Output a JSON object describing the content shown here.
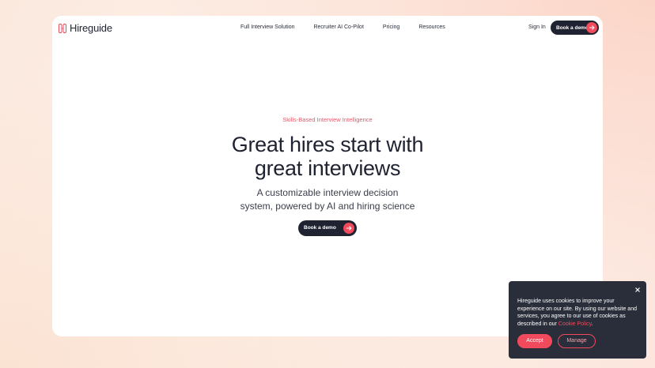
{
  "brand": {
    "name": "Hireguide",
    "accent": "#f04a5c",
    "dark": "#1f2230"
  },
  "nav": {
    "items": [
      {
        "label": "Full Interview Solution"
      },
      {
        "label": "Recruiter AI Co-Pilot"
      },
      {
        "label": "Pricing"
      },
      {
        "label": "Resources"
      }
    ],
    "sign_in": "Sign In",
    "cta": "Book a demo"
  },
  "hero": {
    "eyebrow": "Skills-Based Interview Intelligence",
    "headline_line1": "Great hires start with",
    "headline_line2": "great interviews",
    "sub_line1": "A customizable interview decision",
    "sub_line2": "system, powered by AI and hiring science",
    "cta": "Book a demo"
  },
  "cookie_banner": {
    "text": "Hireguide uses cookies to improve your experience on our site. By using our website and services, you agree to our use of cookies as described in our ",
    "link_text": "Cookie Policy",
    "period": ".",
    "accept": "Accept",
    "manage": "Manage",
    "close_icon": "close-icon"
  }
}
